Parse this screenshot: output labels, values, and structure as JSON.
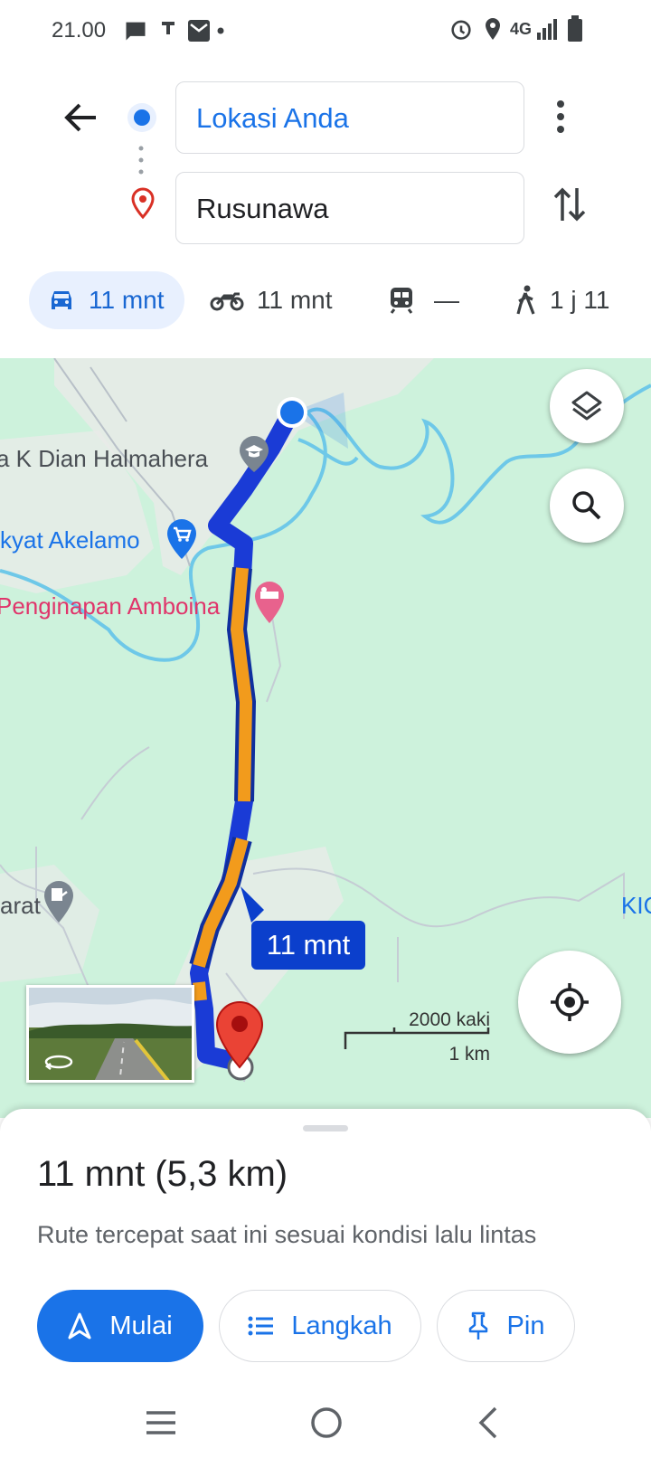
{
  "status_bar": {
    "time": "21.00",
    "network": "4G"
  },
  "directions": {
    "origin": "Lokasi Anda",
    "destination": "Rusunawa"
  },
  "travel_modes": [
    {
      "mode": "car",
      "label": "11 mnt",
      "active": true
    },
    {
      "mode": "motorcycle",
      "label": "11 mnt",
      "active": false
    },
    {
      "mode": "transit",
      "label": "—",
      "active": false
    },
    {
      "mode": "walk",
      "label": "1 j 11",
      "active": false
    }
  ],
  "map": {
    "labels": {
      "school": "a K Dian Halmahera",
      "market": "kyat Akelamo",
      "hotel": "Penginapan Amboina",
      "office": "arat",
      "edge": "KIC"
    },
    "route_time_chip": "11 mnt",
    "scale": {
      "imperial": "2000 kaki",
      "metric": "1 km"
    }
  },
  "sheet": {
    "summary": "11 mnt (5,3 km)",
    "description": "Rute tercepat saat ini sesuai kondisi lalu lintas",
    "buttons": {
      "start": "Mulai",
      "steps": "Langkah",
      "pin": "Pin"
    }
  },
  "colors": {
    "accent": "#1a73e8",
    "route_blue": "#1a3bd6",
    "route_orange": "#f29b1c",
    "map_bg": "#cdf2dc",
    "pin_red": "#ea4335"
  }
}
